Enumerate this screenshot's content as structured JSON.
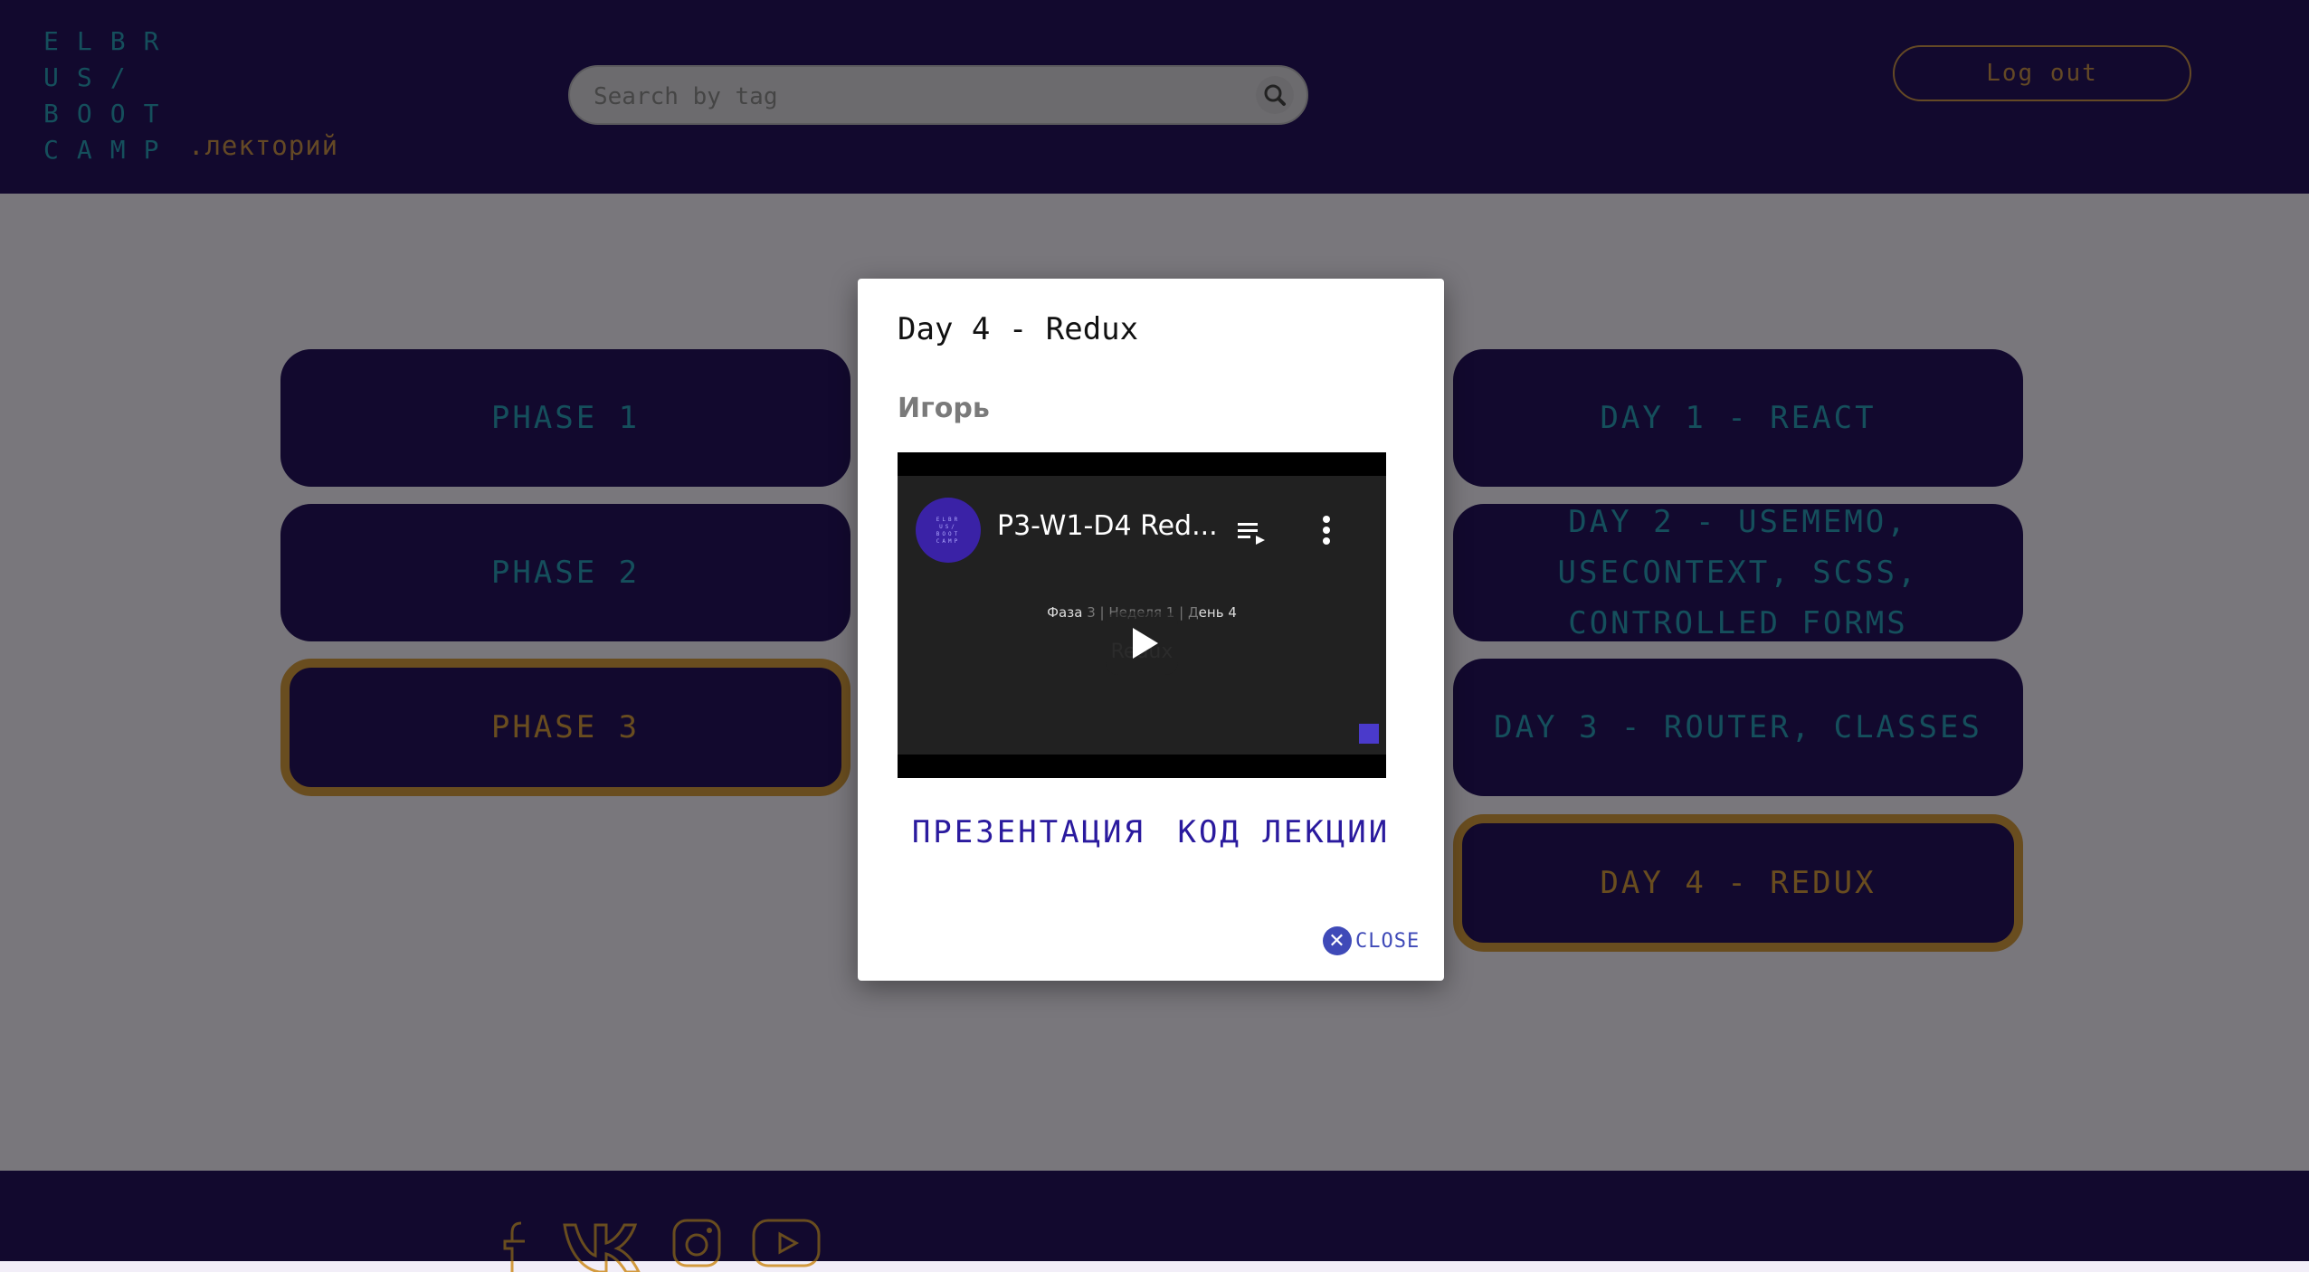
{
  "header": {
    "logo_rows": [
      "ELBR",
      "US/",
      "BOOT",
      "CAMP"
    ],
    "logo_suffix": ".лекторий",
    "search_placeholder": "Search by tag",
    "logout_label": "Log out"
  },
  "phases": [
    {
      "label": "PHASE 1",
      "active": false
    },
    {
      "label": "PHASE 2",
      "active": false
    },
    {
      "label": "PHASE 3",
      "active": true
    }
  ],
  "days": [
    {
      "label": "DAY 1 - REACT",
      "active": false
    },
    {
      "label": "DAY 2 - USEMEMO, USECONTEXT, SCSS, CONTROLLED FORMS",
      "active": false
    },
    {
      "label": "DAY 3 - ROUTER, CLASSES",
      "active": false
    },
    {
      "label": "DAY 4 - REDUX",
      "active": true
    }
  ],
  "modal": {
    "title": "Day 4 - Redux",
    "author": "Игорь",
    "video": {
      "title": "P3-W1-D4 Red...",
      "subtitle_prefix": "Фаза ",
      "subtitle_dim": "3 | Неделя 1 | Д",
      "subtitle_suffix": "ень 4",
      "faded_text": "Redux",
      "avatar_text": "ELBRUS/BOOTCAMP"
    },
    "link_presentation": "ПРЕЗЕНТАЦИЯ",
    "link_code": "КОД ЛЕКЦИИ",
    "close_label": "CLOSE"
  },
  "footer": {
    "socials": [
      "facebook-icon",
      "vk-icon",
      "instagram-icon",
      "youtube-icon"
    ]
  },
  "colors": {
    "brand_dark": "#24125c",
    "accent_orange": "#d39a3e",
    "accent_teal": "#2a9fb8",
    "link_blue": "#2a1a9e"
  }
}
